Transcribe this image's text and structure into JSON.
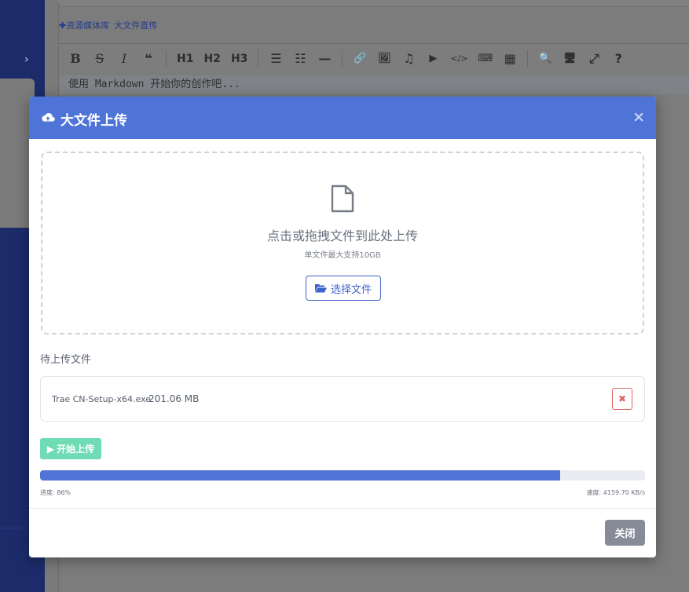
{
  "background": {
    "links": [
      "✚资源媒体库",
      "大文件直传"
    ],
    "toolbar_buttons": [
      "B",
      "S",
      "I",
      "❝",
      "H1",
      "H2",
      "H3",
      "☰",
      "☷",
      "—",
      "🔗",
      "🖼",
      "♫",
      "▶",
      "</>",
      "⌨",
      "▦",
      "🔍",
      "🖥",
      "⤢",
      "?"
    ],
    "editor_placeholder": "使用 Markdown 开始你的创作吧..."
  },
  "modal": {
    "title": "大文件上传",
    "close_icon": "×",
    "dropzone": {
      "main_text": "点击或拖拽文件到此处上传",
      "sub_text": "单文件最大支持10GB",
      "choose_button": "选择文件"
    },
    "pending_label": "待上传文件",
    "files": [
      {
        "name": "Trae CN-Setup-x64.exe",
        "size": "201.06 MB"
      }
    ],
    "start_button": "开始上传",
    "progress": {
      "percent": 86,
      "label": "进度: 86%",
      "speed": "速度: 4159.70 KB/s"
    },
    "close_button": "关闭"
  },
  "colors": {
    "header_bg": "#4f74d8",
    "start_button_bg": "#6fdcb5",
    "remove_button": "#e06363",
    "progress_fill": "#4f74d8"
  }
}
